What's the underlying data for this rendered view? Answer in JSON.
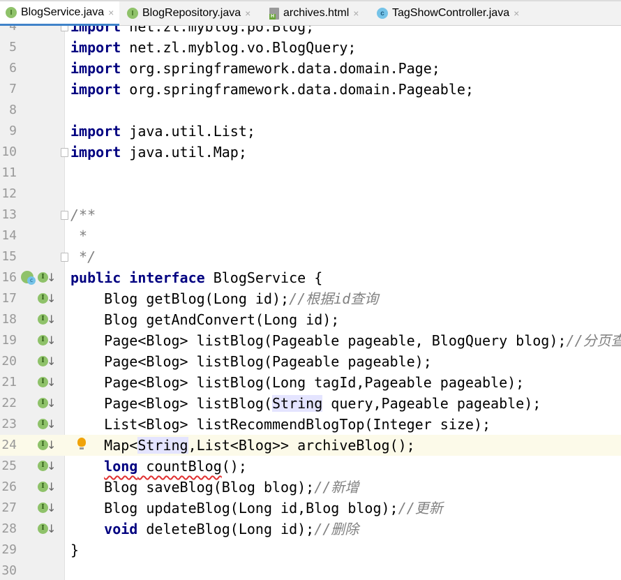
{
  "tabs": [
    {
      "label": "BlogService.java",
      "icon": "interface-icon",
      "active": true
    },
    {
      "label": "BlogRepository.java",
      "icon": "interface-icon",
      "active": false
    },
    {
      "label": "archives.html",
      "icon": "html-file-icon",
      "active": false
    },
    {
      "label": "TagShowController.java",
      "icon": "class-icon",
      "active": false
    }
  ],
  "close_glyph": "×",
  "lines": [
    {
      "n": "4",
      "fold": true,
      "t": [
        [
          "kw",
          "import"
        ],
        [
          "p",
          " net.zl.myblog.po.Blog;"
        ]
      ]
    },
    {
      "n": "5",
      "t": [
        [
          "kw",
          "import"
        ],
        [
          "p",
          " net.zl.myblog.vo.BlogQuery;"
        ]
      ]
    },
    {
      "n": "6",
      "t": [
        [
          "kw",
          "import"
        ],
        [
          "p",
          " org.springframework.data.domain.Page;"
        ]
      ]
    },
    {
      "n": "7",
      "t": [
        [
          "kw",
          "import"
        ],
        [
          "p",
          " org.springframework.data.domain.Pageable;"
        ]
      ]
    },
    {
      "n": "8",
      "t": []
    },
    {
      "n": "9",
      "t": [
        [
          "kw",
          "import"
        ],
        [
          "p",
          " java.util.List;"
        ]
      ]
    },
    {
      "n": "10",
      "fold": true,
      "t": [
        [
          "kw",
          "import"
        ],
        [
          "p",
          " java.util.Map;"
        ]
      ]
    },
    {
      "n": "11",
      "t": []
    },
    {
      "n": "12",
      "t": []
    },
    {
      "n": "13",
      "fold": true,
      "t": [
        [
          "cm",
          "/**"
        ]
      ]
    },
    {
      "n": "14",
      "t": [
        [
          "cm",
          " *"
        ]
      ]
    },
    {
      "n": "15",
      "fold": true,
      "t": [
        [
          "cm",
          " */"
        ]
      ]
    },
    {
      "n": "16",
      "impl": true,
      "gi": true,
      "t": [
        [
          "kw",
          "public"
        ],
        [
          "p",
          " "
        ],
        [
          "kw",
          "interface"
        ],
        [
          "p",
          " BlogService {"
        ]
      ]
    },
    {
      "n": "17",
      "gi": true,
      "t": [
        [
          "p",
          "    Blog getBlog(Long id);"
        ],
        [
          "cm",
          "//根据id查询"
        ]
      ]
    },
    {
      "n": "18",
      "gi": true,
      "t": [
        [
          "p",
          "    Blog getAndConvert(Long id);"
        ]
      ]
    },
    {
      "n": "19",
      "gi": true,
      "t": [
        [
          "p",
          "    Page<Blog> listBlog(Pageable pageable, BlogQuery blog);"
        ],
        [
          "cm",
          "//分页查询"
        ]
      ]
    },
    {
      "n": "20",
      "gi": true,
      "t": [
        [
          "p",
          "    Page<Blog> listBlog(Pageable pageable);"
        ]
      ]
    },
    {
      "n": "21",
      "gi": true,
      "t": [
        [
          "p",
          "    Page<Blog> listBlog(Long tagId,Pageable pageable);"
        ]
      ]
    },
    {
      "n": "22",
      "gi": true,
      "t": [
        [
          "p",
          "    Page<Blog> listBlog("
        ],
        [
          "hl",
          "String"
        ],
        [
          "p",
          " query,Pageable pageable);"
        ]
      ]
    },
    {
      "n": "23",
      "gi": true,
      "t": [
        [
          "p",
          "    List<Blog> listRecommendBlogTop(Integer size);"
        ]
      ]
    },
    {
      "n": "24",
      "gi": true,
      "current": true,
      "bulb": true,
      "t": [
        [
          "p",
          "    Map<"
        ],
        [
          "hl",
          "String"
        ],
        [
          "p",
          ",List<Blog>> archiveBlog();"
        ]
      ]
    },
    {
      "n": "25",
      "gi": true,
      "t": [
        [
          "p",
          "    "
        ],
        [
          "kwerr",
          "long"
        ],
        [
          "err",
          " countBlog"
        ],
        [
          "p",
          "();"
        ]
      ]
    },
    {
      "n": "26",
      "gi": true,
      "t": [
        [
          "p",
          "    Blog saveBlog(Blog blog);"
        ],
        [
          "cm",
          "//新增"
        ]
      ]
    },
    {
      "n": "27",
      "gi": true,
      "t": [
        [
          "p",
          "    Blog updateBlog(Long id,Blog blog);"
        ],
        [
          "cm",
          "//更新"
        ]
      ]
    },
    {
      "n": "28",
      "gi": true,
      "t": [
        [
          "p",
          "    "
        ],
        [
          "kw",
          "void"
        ],
        [
          "p",
          " deleteBlog(Long id);"
        ],
        [
          "cm",
          "//删除"
        ]
      ]
    },
    {
      "n": "29",
      "t": [
        [
          "p",
          "}"
        ]
      ]
    },
    {
      "n": "30",
      "t": []
    }
  ]
}
